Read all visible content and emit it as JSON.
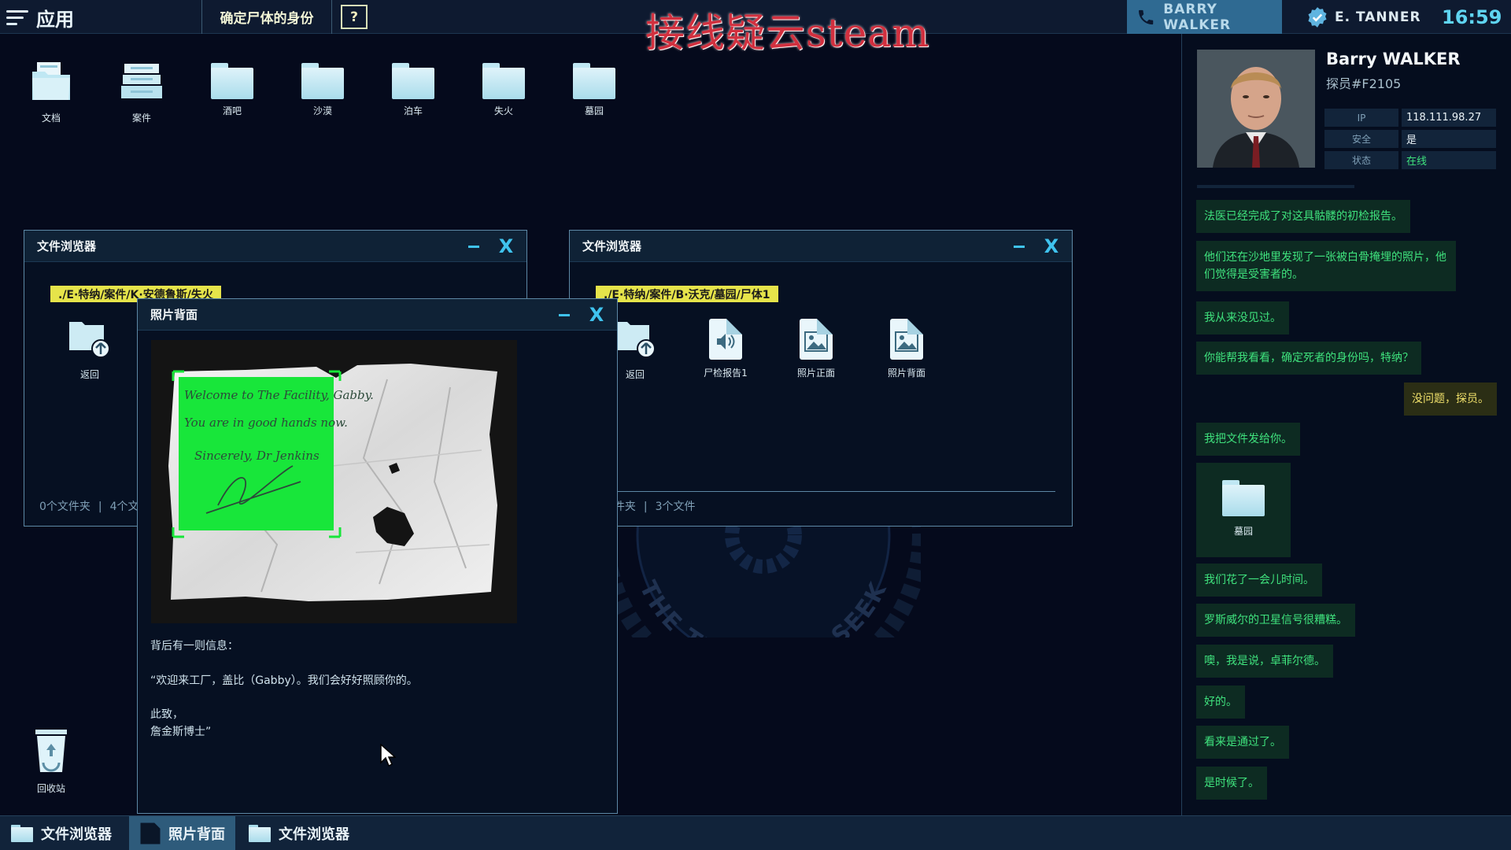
{
  "topbar": {
    "app_menu_label": "应用",
    "task_label": "确定尸体的身份",
    "help_label": "?",
    "watermark": "接线疑云steam",
    "call_contact": "BARRY WALKER",
    "user_name": "E. TANNER",
    "time": "16:59",
    "accent_color": "#5fd4f1"
  },
  "desktop": {
    "icons": [
      {
        "label": "文档",
        "icon": "documents-folder-icon"
      },
      {
        "label": "案件",
        "icon": "cases-cabinet-icon"
      },
      {
        "label": "酒吧",
        "icon": "folder-icon"
      },
      {
        "label": "沙漠",
        "icon": "folder-icon"
      },
      {
        "label": "泊车",
        "icon": "folder-icon"
      },
      {
        "label": "失火",
        "icon": "folder-icon"
      },
      {
        "label": "墓园",
        "icon": "folder-icon"
      }
    ],
    "recycle_label": "回收站",
    "emblem_text": "THE TRUTH WE SEEK"
  },
  "file_browser_left": {
    "title": "文件浏览器",
    "path": "./E·特纳/案件/K·安德鲁斯/失火",
    "items": [
      {
        "label": "返回",
        "icon": "back-folder-icon"
      }
    ],
    "status_folders": "0个文件夹",
    "status_files": "4个文件"
  },
  "file_browser_right": {
    "title": "文件浏览器",
    "path": "./E·特纳/案件/B·沃克/墓园/尸体1",
    "items": [
      {
        "label": "返回",
        "icon": "back-folder-icon"
      },
      {
        "label": "尸检报告1",
        "icon": "audio-file-icon"
      },
      {
        "label": "照片正面",
        "icon": "image-file-icon"
      },
      {
        "label": "照片背面",
        "icon": "image-file-icon"
      }
    ],
    "status_folders": "0个文件夹",
    "status_files": "3个文件"
  },
  "photo_window": {
    "title": "照片背面",
    "note_lines": [
      "Welcome to The Facility, Gabby.",
      "You are in good hands now.",
      "Sincerely, Dr Jenkins"
    ],
    "caption_intro": "背后有一则信息：",
    "caption_quote": "“欢迎来工厂，盖比（Gabby）。我们会好好照顾你的。",
    "caption_signoff": "此致，",
    "caption_signature": "詹金斯博士”",
    "highlight_color": "#18e63a"
  },
  "contact": {
    "name": "Barry WALKER",
    "id": "探员#F2105",
    "ip_label": "IP",
    "ip_value": "118.111.98.27",
    "secure_label": "安全",
    "secure_value": "是",
    "status_label": "状态",
    "status_value": "在线",
    "status_color": "#3fe27d"
  },
  "chat": {
    "messages": [
      {
        "from": "barry",
        "text": "法医已经完成了对这具骷髅的初检报告。"
      },
      {
        "from": "barry",
        "text": "他们还在沙地里发现了一张被白骨掩埋的照片，他们觉得是受害者的。"
      },
      {
        "from": "barry",
        "text": "我从来没见过。"
      },
      {
        "from": "barry",
        "text": "你能帮我看看，确定死者的身份吗，特纳？"
      },
      {
        "from": "me",
        "text": "没问题，探员。"
      },
      {
        "from": "barry",
        "text": "我把文件发给你。"
      },
      {
        "from": "barry",
        "text": "我们花了一会儿时间。"
      },
      {
        "from": "barry",
        "text": "罗斯威尔的卫星信号很糟糕。"
      },
      {
        "from": "barry",
        "text": "噢，我是说，卓菲尔德。"
      },
      {
        "from": "barry",
        "text": "好的。"
      },
      {
        "from": "barry",
        "text": "看来是通过了。"
      },
      {
        "from": "barry",
        "text": "是时候了。"
      }
    ],
    "shared_file_label": "墓园"
  },
  "taskbar": {
    "items": [
      {
        "label": "文件浏览器",
        "active": false
      },
      {
        "label": "照片背面",
        "active": true
      },
      {
        "label": "文件浏览器",
        "active": false
      }
    ]
  }
}
